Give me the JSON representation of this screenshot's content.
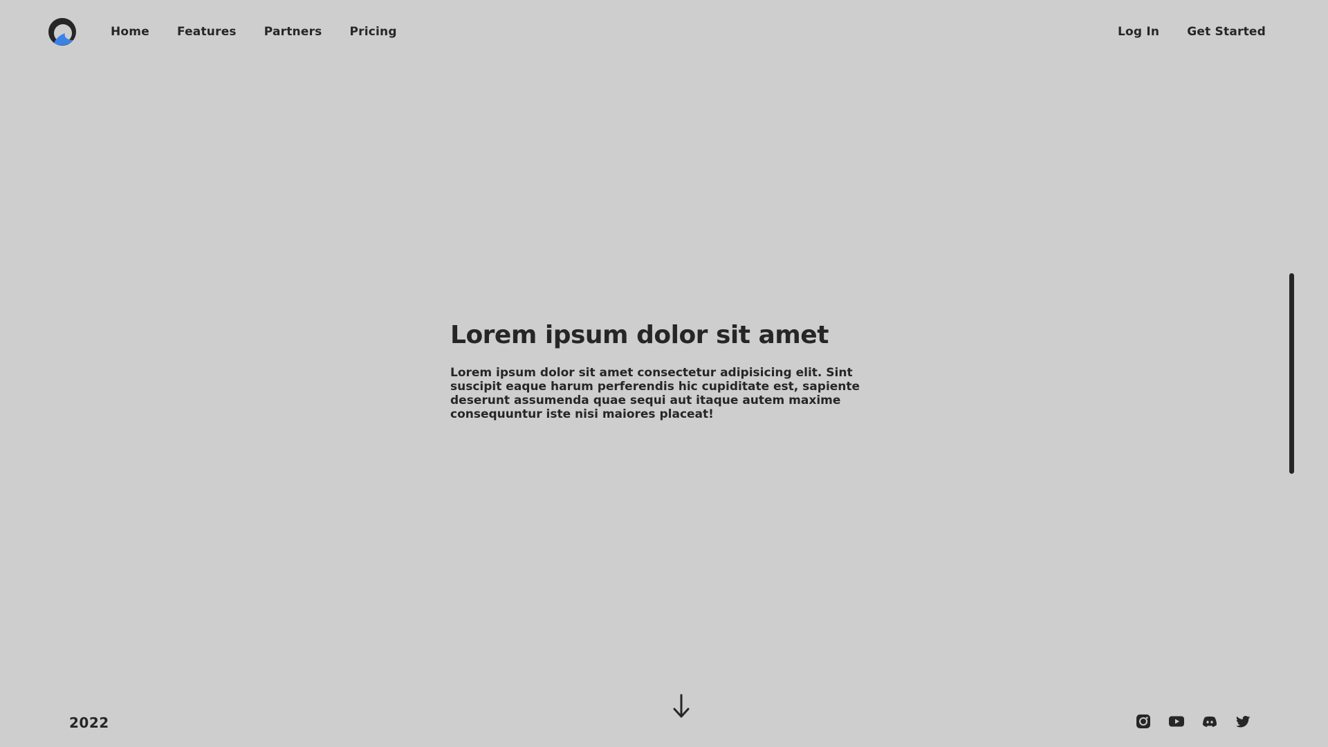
{
  "brand": {
    "logo_icon": "crescent-wave-logo",
    "accent_color": "#3b82e6"
  },
  "nav": {
    "left": [
      {
        "label": "Home"
      },
      {
        "label": "Features"
      },
      {
        "label": "Partners"
      },
      {
        "label": "Pricing"
      }
    ],
    "right": [
      {
        "label": "Log In"
      },
      {
        "label": "Get Started"
      }
    ]
  },
  "hero": {
    "title": "Lorem ipsum dolor sit amet",
    "body": "Lorem ipsum dolor sit amet consectetur adipisicing elit. Sint suscipit eaque harum perferendis hic cupiditate est, sapiente deserunt assumenda quae sequi aut itaque autem maxime consequuntur iste nisi maiores placeat!"
  },
  "footer": {
    "year": "2022",
    "scroll_icon": "arrow-down-icon",
    "socials": [
      {
        "icon": "instagram-icon"
      },
      {
        "icon": "youtube-icon"
      },
      {
        "icon": "discord-icon"
      },
      {
        "icon": "twitter-icon"
      }
    ]
  },
  "colors": {
    "background": "#cecece",
    "text": "#262626"
  }
}
